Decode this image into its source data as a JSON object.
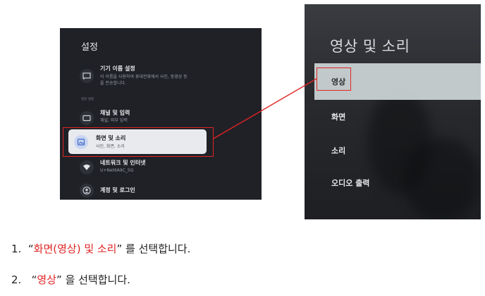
{
  "left_screen": {
    "title": "설정",
    "device_name": {
      "title": "기기 이름 설정",
      "desc_line1": "이 이름을 사용하여 휴대전화에서 사진, 동영상 등",
      "desc_line2": "을 전송합니다."
    },
    "section_label": "일반 설정",
    "channel": {
      "title": "채널 및 입력",
      "desc": "채널, 외부 입력"
    },
    "display_sound": {
      "title": "화면 및 소리",
      "desc": "사진, 화면, 소리"
    },
    "network": {
      "title": "네트워크 및 인터넷",
      "desc": "U+Net6A9C_5G"
    },
    "account": {
      "title": "계정 및 로그인"
    }
  },
  "right_screen": {
    "title": "영상 및 소리",
    "items": [
      "영상",
      "화면",
      "소리",
      "오디오 출력"
    ]
  },
  "instructions": [
    {
      "num": "1.",
      "q_open": "“",
      "highlight": "화면(영상) 및 소리",
      "q_close": "”",
      "rest": " 를 선택합니다."
    },
    {
      "num": "2.",
      "q_open": "“",
      "highlight": "영상",
      "q_close": "”",
      "rest": " 을 선택합니다."
    }
  ],
  "colors": {
    "highlight_red": "#e02424",
    "panel_dark": "#1f2127",
    "selected_card": "#e9eaee"
  }
}
